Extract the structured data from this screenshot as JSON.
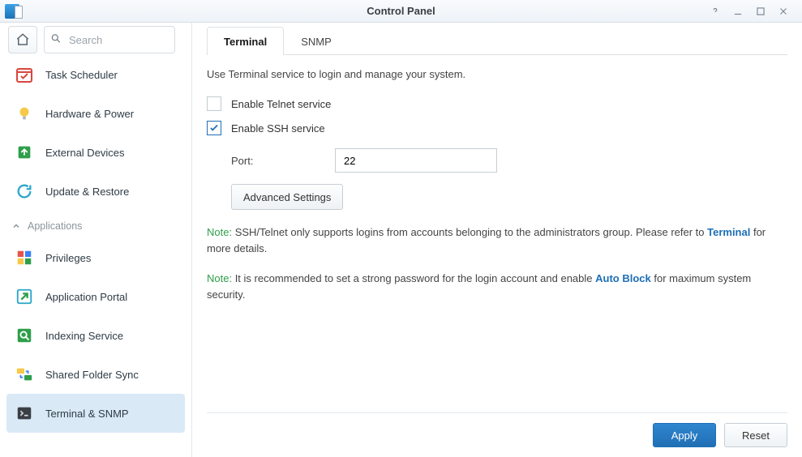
{
  "window": {
    "title": "Control Panel"
  },
  "search": {
    "placeholder": "Search"
  },
  "sidebar": {
    "items": [
      {
        "label": "Task Scheduler"
      },
      {
        "label": "Hardware & Power"
      },
      {
        "label": "External Devices"
      },
      {
        "label": "Update & Restore"
      }
    ],
    "section": "Applications",
    "apps": [
      {
        "label": "Privileges"
      },
      {
        "label": "Application Portal"
      },
      {
        "label": "Indexing Service"
      },
      {
        "label": "Shared Folder Sync"
      },
      {
        "label": "Terminal & SNMP"
      }
    ]
  },
  "tabs": {
    "terminal": "Terminal",
    "snmp": "SNMP"
  },
  "pane": {
    "desc": "Use Terminal service to login and manage your system.",
    "telnet_label": "Enable Telnet service",
    "ssh_label": "Enable SSH service",
    "port_label": "Port:",
    "port_value": "22",
    "advanced": "Advanced Settings"
  },
  "notes": {
    "label": "Note:",
    "n1a": " SSH/Telnet only supports logins from accounts belonging to the administrators group. Please refer to ",
    "n1link": "Terminal",
    "n1b": " for more details.",
    "n2a": " It is recommended to set a strong password for the login account and enable ",
    "n2link": "Auto Block",
    "n2b": " for maximum system security."
  },
  "footer": {
    "apply": "Apply",
    "reset": "Reset"
  }
}
